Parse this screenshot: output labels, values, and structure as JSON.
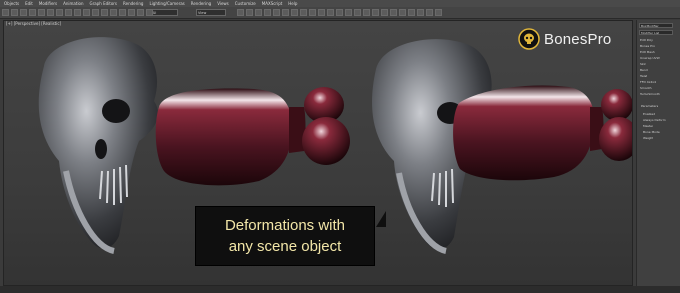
{
  "menubar": {
    "items": [
      "Objects",
      "Edit",
      "Modifiers",
      "Animation",
      "Graph Editors",
      "Rendering",
      "Lighting/Cameras",
      "Rendering",
      "Views",
      "Customize",
      "MAXScript",
      "Help"
    ]
  },
  "toolbar": {
    "selection_filter": "All",
    "view_dropdown": "View"
  },
  "viewport": {
    "label": "[+] [Perspective] [Realistic]"
  },
  "command_panel": {
    "object_name": "BoxModifier",
    "modifier_list": "Modifier List",
    "rows": [
      "Edit Poly",
      "Bones Pro",
      "Edit Mesh",
      "Unwrap UVW",
      "Skin",
      "Bend",
      "Twist",
      "FFD 4x4x4",
      "Smooth",
      "TurboSmooth"
    ],
    "parameters_label": "Parameters",
    "option_labels": [
      "Enabled",
      "Always Deform",
      "Master",
      "Bone Mode",
      "Weight"
    ]
  },
  "badge": {
    "text": "BonesPro"
  },
  "caption": {
    "line1": "Deformations with",
    "line2": "any scene object"
  },
  "colors": {
    "caption_text": "#f2e6a8",
    "capsule": "#5a1422",
    "skull": "#7a7c80"
  }
}
